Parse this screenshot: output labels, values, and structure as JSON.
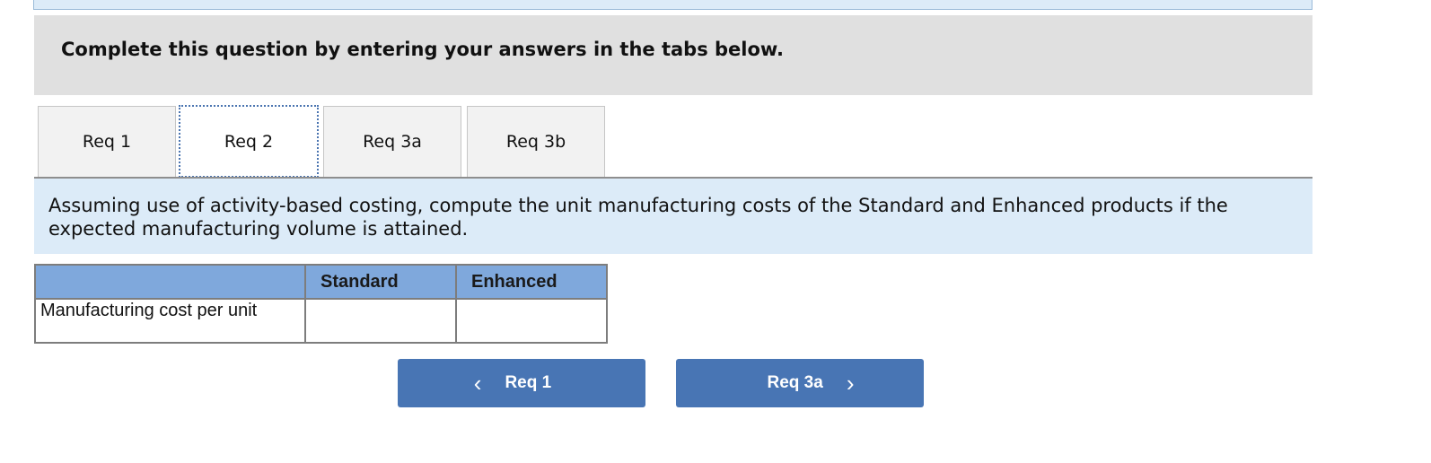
{
  "instructions": "Complete this question by entering your answers in the tabs below.",
  "tabs": [
    {
      "label": "Req 1",
      "active": false
    },
    {
      "label": "Req 2",
      "active": true
    },
    {
      "label": "Req 3a",
      "active": false
    },
    {
      "label": "Req 3b",
      "active": false
    }
  ],
  "prompt": "Assuming use of activity-based costing, compute the unit manufacturing costs of the Standard and Enhanced products if the expected manufacturing volume is attained.",
  "table": {
    "headers": [
      "",
      "Standard",
      "Enhanced"
    ],
    "rows": [
      {
        "label": "Manufacturing cost per unit",
        "standard": "",
        "enhanced": ""
      }
    ]
  },
  "nav": {
    "prev": {
      "label": "Req 1",
      "icon": "chevron-left-icon"
    },
    "next": {
      "label": "Req 3a",
      "icon": "chevron-right-icon"
    }
  },
  "colors": {
    "accent": "#4875b4",
    "header_fill": "#7fa8dc",
    "prompt_bg": "#dcebf8",
    "instructions_bg": "#e0e0e0"
  }
}
